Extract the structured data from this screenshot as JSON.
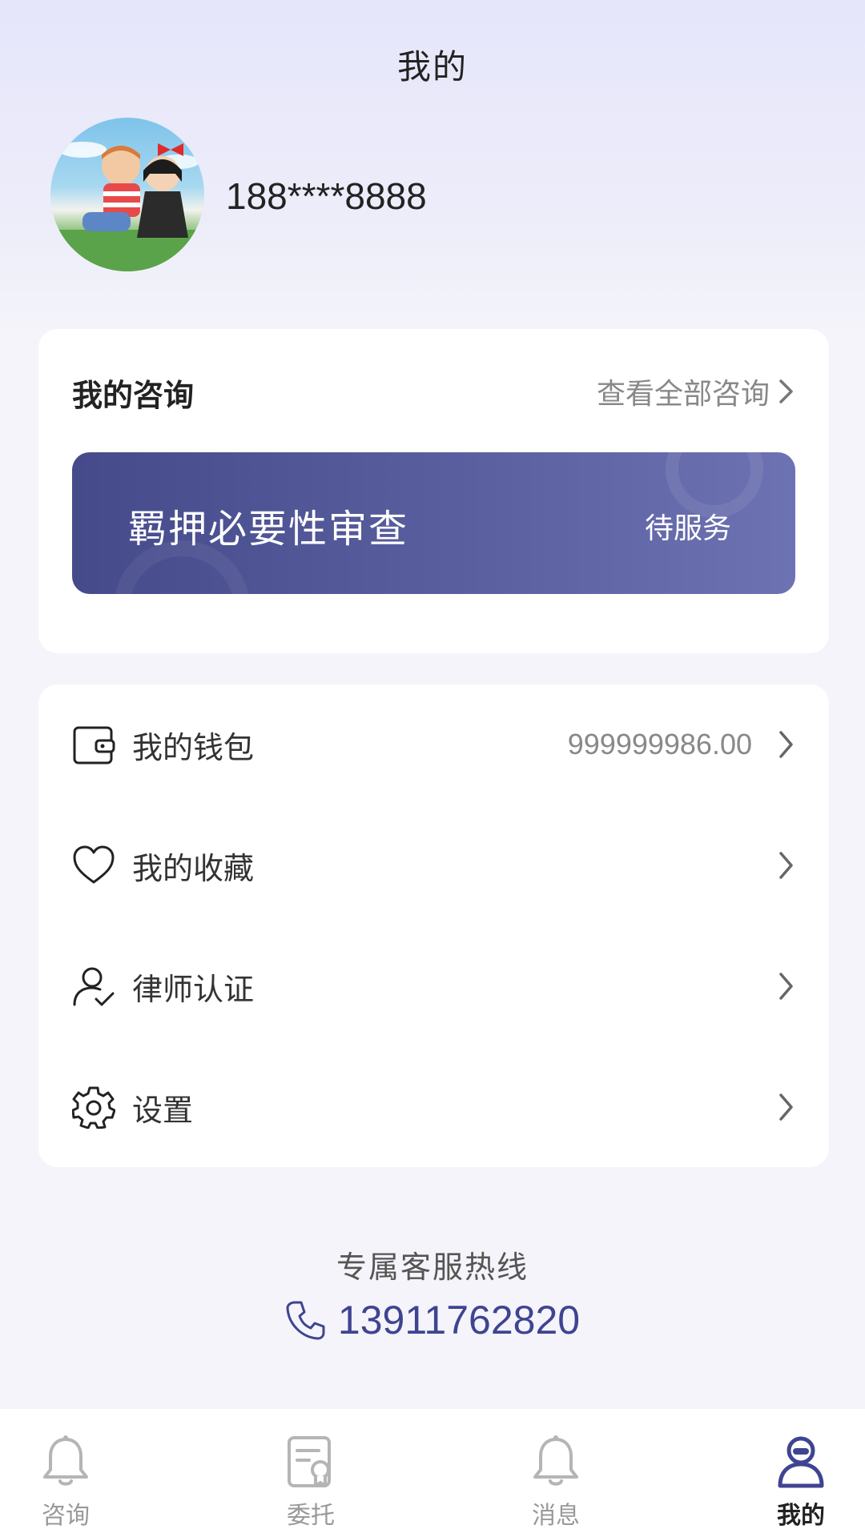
{
  "header": {
    "title": "我的"
  },
  "user": {
    "phone": "188****8888"
  },
  "consult": {
    "title": "我的咨询",
    "view_all": "查看全部咨询",
    "item": {
      "title": "羁押必要性审查",
      "status": "待服务"
    }
  },
  "menu": {
    "items": [
      {
        "label": "我的钱包",
        "value": "999999986.00",
        "icon": "wallet-icon"
      },
      {
        "label": "我的收藏",
        "value": "",
        "icon": "heart-icon"
      },
      {
        "label": "律师认证",
        "value": "",
        "icon": "user-check-icon"
      },
      {
        "label": "设置",
        "value": "",
        "icon": "gear-icon"
      }
    ]
  },
  "hotline": {
    "label": "专属客服热线",
    "number": "13911762820"
  },
  "tabs": [
    {
      "label": "咨询",
      "icon": "bell-icon"
    },
    {
      "label": "委托",
      "icon": "document-badge-icon"
    },
    {
      "label": "消息",
      "icon": "bell-icon"
    },
    {
      "label": "我的",
      "icon": "user-icon",
      "active": true
    }
  ],
  "colors": {
    "accent": "#3f4491",
    "banner_start": "#454a8a",
    "banner_end": "#6d72b2",
    "background": "#f4f4fa"
  }
}
